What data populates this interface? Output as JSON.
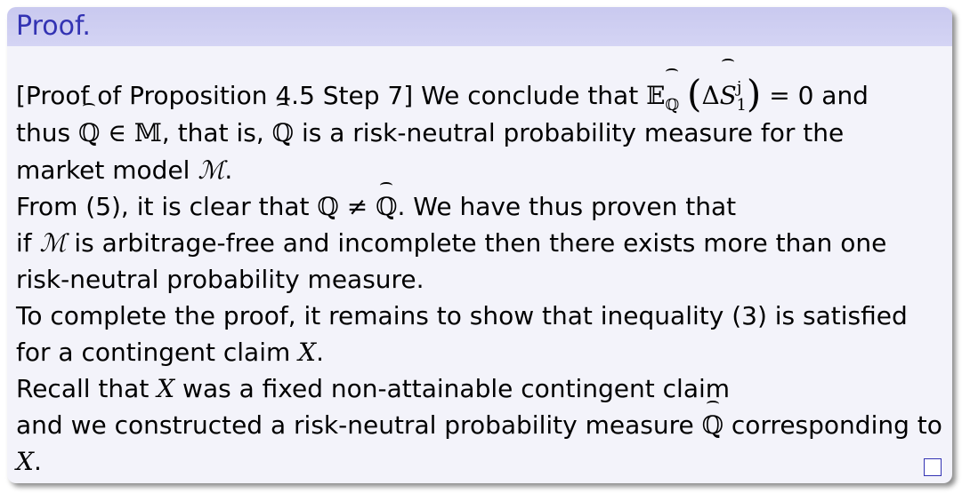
{
  "block": {
    "title": "Proof.",
    "line1_a": "[Proof of Proposition 4.5 Step 7] We conclude that",
    "line1_b": "= 0 and",
    "line2_a": "thus",
    "line2_b": "∈",
    "line2_c": ", that is,",
    "line2_d": "is a risk-neutral probability measure for the",
    "line3_a": "market model",
    "line3_b": ".",
    "line4_a": "From (5), it is clear that",
    "line4_b": ". We have thus proven that",
    "line5_a": "if",
    "line5_b": "is arbitrage-free and incomplete then there exists more than one",
    "line6": "risk-neutral probability measure.",
    "line7": "To complete the proof, it remains to show that inequality (3) is satisfied",
    "line8_a": "for a contingent claim",
    "line8_b": ".",
    "line9_a": "Recall that",
    "line9_b": "was a fixed non-attainable contingent claim",
    "line10_a": "and we constructed a risk-neutral probability measure",
    "line10_b": "corresponding to",
    "line11_b": "."
  },
  "math": {
    "E": "𝔼",
    "Q": "ℚ",
    "M_set": "𝕄",
    "M_model": "ℳ",
    "X": "X",
    "Delta": "Δ",
    "S": "S",
    "sub1": "1",
    "supj": "j",
    "neq": "≠",
    "lparen": "(",
    "rparen": ")"
  },
  "colors": {
    "title_text": "#3333b3",
    "title_bg": "#cfcff2",
    "body_bg": "#f3f3fa"
  },
  "icons": [
    "qed-square-icon"
  ]
}
